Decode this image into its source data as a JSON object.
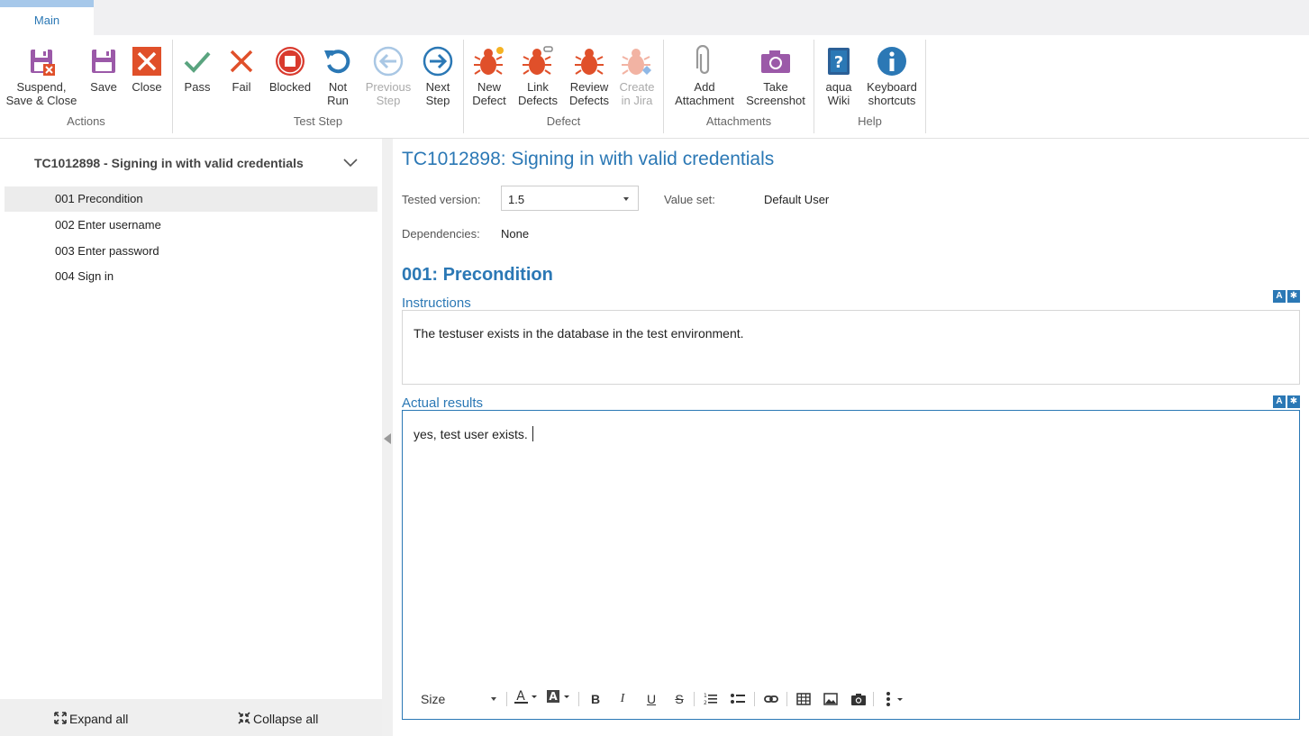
{
  "ribbon": {
    "tab_main": "Main",
    "groups": {
      "actions": "Actions",
      "test_step": "Test Step",
      "defect": "Defect",
      "attachments": "Attachments",
      "help": "Help"
    },
    "buttons": {
      "suspend_l1": "Suspend,",
      "suspend_l2": "Save & Close",
      "save": "Save",
      "close": "Close",
      "pass": "Pass",
      "fail": "Fail",
      "blocked": "Blocked",
      "notrun_l1": "Not",
      "notrun_l2": "Run",
      "prev_l1": "Previous",
      "prev_l2": "Step",
      "next_l1": "Next",
      "next_l2": "Step",
      "newdef_l1": "New",
      "newdef_l2": "Defect",
      "linkdef_l1": "Link",
      "linkdef_l2": "Defects",
      "reviewdef_l1": "Review",
      "reviewdef_l2": "Defects",
      "jira_l1": "Create",
      "jira_l2": "in Jira",
      "attach_l1": "Add",
      "attach_l2": "Attachment",
      "screenshot_l1": "Take",
      "screenshot_l2": "Screenshot",
      "wiki_l1": "aqua",
      "wiki_l2": "Wiki",
      "keys_l1": "Keyboard",
      "keys_l2": "shortcuts"
    }
  },
  "tree": {
    "title": "TC1012898 - Signing in with valid credentials",
    "items": [
      {
        "label": "001 Precondition"
      },
      {
        "label": "002 Enter username"
      },
      {
        "label": "003 Enter password"
      },
      {
        "label": "004 Sign in"
      }
    ],
    "expand_all": "Expand all",
    "collapse_all": "Collapse all"
  },
  "main": {
    "title": "TC1012898: Signing in with valid credentials",
    "tested_version_label": "Tested version:",
    "tested_version_value": "1.5",
    "value_set_label": "Value set:",
    "value_set_value": "Default User",
    "dependencies_label": "Dependencies:",
    "dependencies_value": "None",
    "step_heading": "001: Precondition",
    "instructions_label": "Instructions",
    "instructions_text": "The testuser exists in the database in the test environment.",
    "actual_results_label": "Actual results",
    "actual_results_text": "yes, test user exists.",
    "editor_size_label": "Size"
  },
  "colors": {
    "accent": "#2b78b5",
    "defect": "#e0502a",
    "purple": "#9b59a8"
  }
}
